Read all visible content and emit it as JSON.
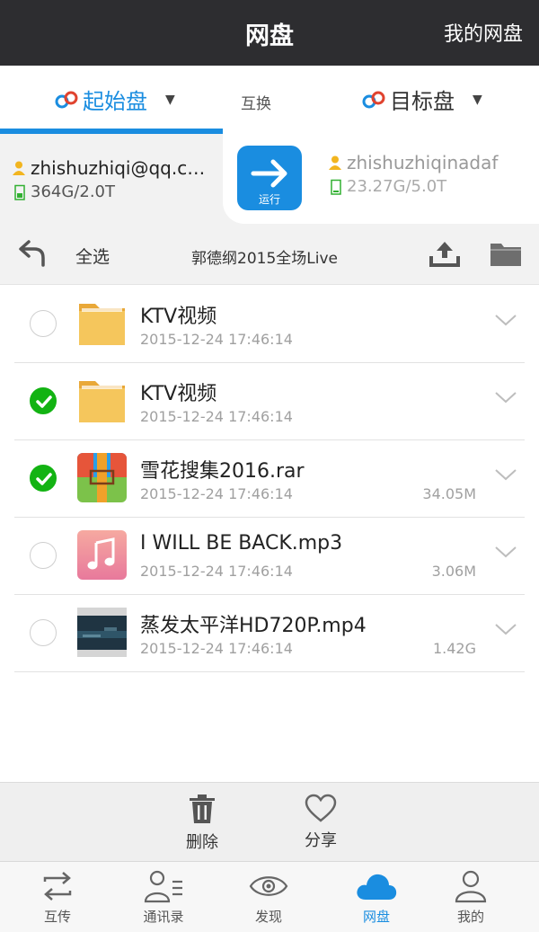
{
  "header": {
    "title": "网盘",
    "right_link": "我的网盘"
  },
  "selector": {
    "source_label": "起始盘",
    "swap_label": "互换",
    "target_label": "目标盘"
  },
  "source_account": {
    "name": "zhishuzhiqi@qq.c…",
    "capacity": "364G/2.0T"
  },
  "target_account": {
    "name": "zhishuzhiqinadaf",
    "capacity": "23.27G/5.0T"
  },
  "run_button": {
    "label": "运行"
  },
  "toolbar": {
    "select_all": "全选",
    "path": "郭德纲2015全场Live"
  },
  "files": [
    {
      "name": "KTV视频",
      "date": "2015-12-24 17:46:14",
      "size": "",
      "checked": false,
      "type": "folder"
    },
    {
      "name": "KTV视频",
      "date": "2015-12-24 17:46:14",
      "size": "",
      "checked": true,
      "type": "folder"
    },
    {
      "name": "雪花搜集2016.rar",
      "date": "2015-12-24 17:46:14",
      "size": "34.05M",
      "checked": true,
      "type": "archive"
    },
    {
      "name": "I WILL BE BACK.mp3",
      "date": "2015-12-24 17:46:14",
      "size": "3.06M",
      "checked": false,
      "type": "music"
    },
    {
      "name": "蒸发太平洋HD720P.mp4",
      "date": "2015-12-24 17:46:14",
      "size": "1.42G",
      "checked": false,
      "type": "video"
    }
  ],
  "actions": {
    "delete": "删除",
    "share": "分享"
  },
  "tabs": [
    {
      "label": "互传",
      "icon": "transfer-icon",
      "active": false
    },
    {
      "label": "通讯录",
      "icon": "contacts-icon",
      "active": false
    },
    {
      "label": "发现",
      "icon": "eye-icon",
      "active": false
    },
    {
      "label": "网盘",
      "icon": "cloud-icon",
      "active": true
    },
    {
      "label": "我的",
      "icon": "person-icon",
      "active": false
    }
  ],
  "colors": {
    "accent": "#1a8de0",
    "check": "#13b313",
    "topbar": "#2d2d30"
  }
}
